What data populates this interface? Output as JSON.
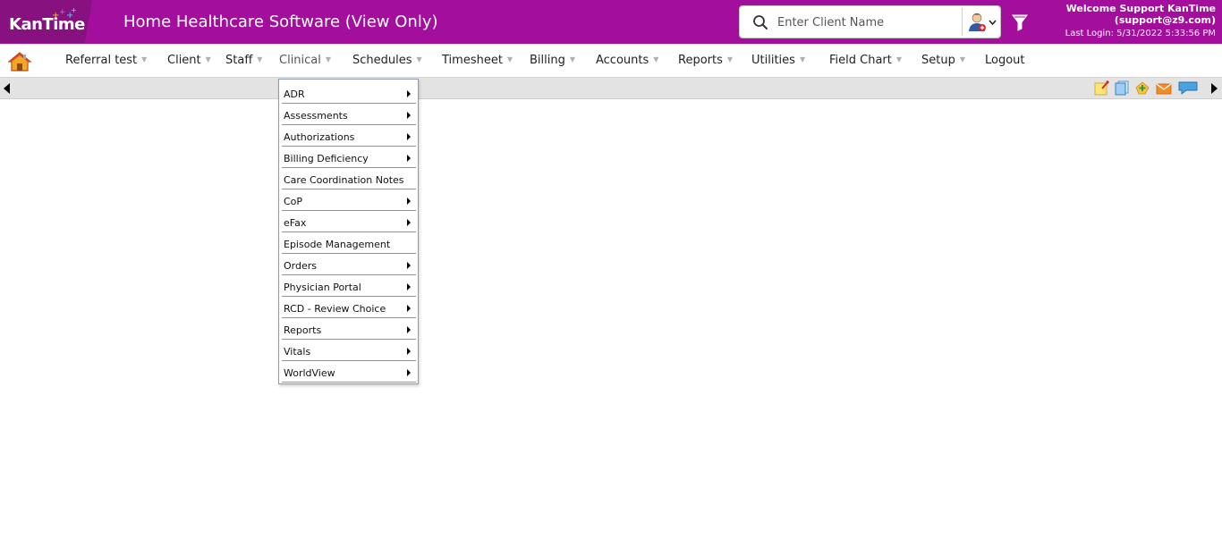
{
  "header": {
    "logo_text": "KanTime",
    "title": "Home Healthcare Software (View Only)",
    "search_placeholder": "Enter Client Name",
    "welcome_line1": "Welcome Support KanTime",
    "welcome_line2": "(support@z9.com)",
    "last_login": "Last Login: 5/31/2022 5:33:56 PM",
    "brand_color": "#a30e9d"
  },
  "nav": {
    "items": [
      {
        "label": "Referral test",
        "has_caret": true
      },
      {
        "label": "Client",
        "has_caret": true
      },
      {
        "label": "Staff",
        "has_caret": true
      },
      {
        "label": "Clinical",
        "has_caret": true,
        "active": true
      },
      {
        "label": "Schedules",
        "has_caret": true
      },
      {
        "label": "Timesheet",
        "has_caret": true
      },
      {
        "label": "Billing",
        "has_caret": true
      },
      {
        "label": "Accounts",
        "has_caret": true
      },
      {
        "label": "Reports",
        "has_caret": true
      },
      {
        "label": "Utilities",
        "has_caret": true
      },
      {
        "label": "Field Chart",
        "has_caret": true
      },
      {
        "label": "Setup",
        "has_caret": true
      },
      {
        "label": "Logout",
        "has_caret": false
      }
    ],
    "caret_glyph": "▼"
  },
  "toolbar": {
    "icons": [
      "sticky-note-icon",
      "copy-icon",
      "add-note-icon",
      "mail-icon",
      "chat-icon"
    ]
  },
  "clinical_menu": {
    "items": [
      {
        "label": "ADR",
        "has_submenu": true
      },
      {
        "label": "Assessments",
        "has_submenu": true
      },
      {
        "label": "Authorizations",
        "has_submenu": true
      },
      {
        "label": "Billing Deficiency",
        "has_submenu": true
      },
      {
        "label": "Care Coordination Notes",
        "has_submenu": false
      },
      {
        "label": "CoP",
        "has_submenu": true
      },
      {
        "label": "eFax",
        "has_submenu": true
      },
      {
        "label": "Episode Management",
        "has_submenu": false
      },
      {
        "label": "Orders",
        "has_submenu": true
      },
      {
        "label": "Physician Portal",
        "has_submenu": true
      },
      {
        "label": "RCD - Review Choice",
        "has_submenu": true
      },
      {
        "label": "Reports",
        "has_submenu": true
      },
      {
        "label": "Vitals",
        "has_submenu": true
      },
      {
        "label": "WorldView",
        "has_submenu": true
      }
    ]
  }
}
